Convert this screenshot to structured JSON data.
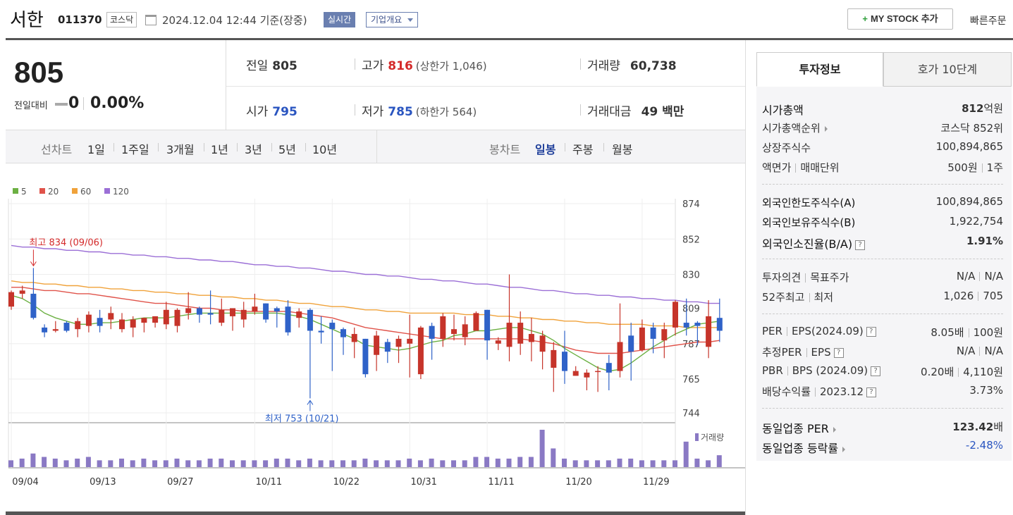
{
  "header": {
    "stock_name": "서한",
    "stock_code": "011370",
    "market_badge": "코스닥",
    "timestamp": "2024.12.04 12:44 기준(장중)",
    "realtime_badge": "실시간",
    "company_overview": "기업개요",
    "my_stock_label": "MY STOCK 추가",
    "quick_order": "빠른주문"
  },
  "price": {
    "current": "805",
    "change_label": "전일대비",
    "change": "0",
    "change_pct": "0.00%"
  },
  "stats": {
    "prev_close_label": "전일",
    "prev_close": "805",
    "high_label": "고가",
    "high": "816",
    "upper_limit": "(상한가 1,046)",
    "volume_label": "거래량",
    "volume": "60,738",
    "open_label": "시가",
    "open": "795",
    "low_label": "저가",
    "low": "785",
    "lower_limit": "(하한가 564)",
    "amount_label": "거래대금",
    "amount": "49 백만"
  },
  "controls": {
    "line_chart_label": "선차트",
    "line_periods": [
      "1일",
      "1주일",
      "3개월",
      "1년",
      "3년",
      "5년",
      "10년"
    ],
    "candle_chart_label": "봉차트",
    "candle_periods": [
      "일봉",
      "주봉",
      "월봉"
    ],
    "active_candle": "일봉"
  },
  "chart_data": {
    "type": "candlestick",
    "legend": [
      {
        "name": "5",
        "color": "#6cb043"
      },
      {
        "name": "20",
        "color": "#e0534a"
      },
      {
        "name": "60",
        "color": "#f0a23a"
      },
      {
        "name": "120",
        "color": "#9b6fd6"
      }
    ],
    "y_ticks": [
      874,
      852,
      830,
      809,
      787,
      765,
      744
    ],
    "ylim": [
      740,
      880
    ],
    "x_ticks": [
      "09/04",
      "09/13",
      "09/27",
      "10/11",
      "10/22",
      "10/31",
      "11/11",
      "11/20",
      "11/29"
    ],
    "x_tick_index": [
      0,
      7,
      14,
      22,
      29,
      36,
      43,
      50,
      57
    ],
    "high_annotation": "최고 834 (09/06)",
    "high_index": 2,
    "high_value": 834,
    "low_annotation": "최저 753 (10/21)",
    "low_index": 27,
    "low_value": 753,
    "volume_legend": "거래량",
    "candles": [
      [
        810,
        819,
        820,
        808
      ],
      [
        818,
        820,
        823,
        815
      ],
      [
        818,
        803,
        834,
        802
      ],
      [
        797,
        794,
        799,
        791
      ],
      [
        795,
        796,
        801,
        794
      ],
      [
        800,
        795,
        801,
        794
      ],
      [
        796,
        801,
        803,
        791
      ],
      [
        798,
        805,
        807,
        794
      ],
      [
        803,
        798,
        808,
        794
      ],
      [
        802,
        806,
        810,
        796
      ],
      [
        796,
        802,
        806,
        794
      ],
      [
        797,
        802,
        804,
        791
      ],
      [
        800,
        803,
        803,
        794
      ],
      [
        800,
        804,
        804,
        797
      ],
      [
        799,
        808,
        813,
        796
      ],
      [
        798,
        808,
        809,
        794
      ],
      [
        806,
        809,
        819,
        802
      ],
      [
        809,
        805,
        810,
        800
      ],
      [
        806,
        805,
        820,
        799
      ],
      [
        800,
        808,
        815,
        798
      ],
      [
        804,
        809,
        809,
        795
      ],
      [
        802,
        808,
        813,
        797
      ],
      [
        807,
        810,
        818,
        805
      ],
      [
        812,
        802,
        812,
        800
      ],
      [
        809,
        807,
        810,
        797
      ],
      [
        810,
        794,
        814,
        792
      ],
      [
        803,
        807,
        809,
        797
      ],
      [
        808,
        795,
        809,
        753
      ],
      [
        795,
        794,
        804,
        787
      ],
      [
        800,
        796,
        802,
        770
      ],
      [
        796,
        791,
        797,
        780
      ],
      [
        788,
        793,
        797,
        778
      ],
      [
        790,
        768,
        790,
        766
      ],
      [
        780,
        792,
        795,
        770
      ],
      [
        788,
        782,
        790,
        775
      ],
      [
        785,
        790,
        792,
        775
      ],
      [
        787,
        790,
        805,
        766
      ],
      [
        768,
        797,
        798,
        765
      ],
      [
        798,
        790,
        800,
        777
      ],
      [
        790,
        804,
        806,
        785
      ],
      [
        793,
        796,
        805,
        789
      ],
      [
        791,
        799,
        804,
        786
      ],
      [
        795,
        806,
        807,
        795
      ],
      [
        808,
        789,
        808,
        777
      ],
      [
        787,
        789,
        791,
        783
      ],
      [
        785,
        800,
        830,
        776
      ],
      [
        787,
        800,
        807,
        780
      ],
      [
        788,
        793,
        803,
        776
      ],
      [
        782,
        792,
        795,
        771
      ],
      [
        772,
        783,
        788,
        757
      ],
      [
        782,
        770,
        795,
        762
      ],
      [
        767,
        770,
        773,
        767
      ],
      [
        766,
        769,
        771,
        758
      ],
      [
        770,
        770,
        773,
        757
      ],
      [
        775,
        769,
        780,
        758
      ],
      [
        770,
        788,
        812,
        766
      ],
      [
        792,
        782,
        800,
        764
      ],
      [
        783,
        797,
        802,
        782
      ],
      [
        797,
        790,
        800,
        781
      ],
      [
        789,
        796,
        800,
        778
      ],
      [
        797,
        813,
        814,
        792
      ],
      [
        800,
        797,
        815,
        792
      ],
      [
        800,
        798,
        801,
        786
      ],
      [
        785,
        804,
        814,
        778
      ],
      [
        803,
        795,
        815,
        788
      ]
    ],
    "volumes": [
      4,
      5,
      8,
      6,
      5,
      4,
      5,
      6,
      4,
      4,
      5,
      4,
      5,
      4,
      4,
      5,
      4,
      4,
      5,
      5,
      4,
      4,
      4,
      4,
      5,
      5,
      4,
      5,
      4,
      4,
      4,
      4,
      5,
      4,
      4,
      4,
      5,
      4,
      5,
      4,
      4,
      4,
      6,
      6,
      5,
      5,
      6,
      6,
      22,
      11,
      5,
      4,
      4,
      4,
      4,
      5,
      5,
      4,
      4,
      4,
      4,
      15,
      5,
      4,
      7,
      5
    ],
    "ma5": [
      817,
      815,
      811,
      806,
      803,
      801,
      799,
      799,
      800,
      800,
      801,
      802,
      803,
      803,
      803,
      804,
      805,
      806,
      806,
      806,
      806,
      806,
      806,
      806,
      806,
      805,
      804,
      802,
      799,
      796,
      793,
      790,
      786,
      785,
      784,
      783,
      784,
      786,
      788,
      789,
      792,
      793,
      795,
      795,
      796,
      797,
      797,
      795,
      793,
      789,
      784,
      780,
      776,
      772,
      770,
      771,
      775,
      780,
      785,
      789,
      793,
      796,
      799,
      800,
      801
    ],
    "ma20": [
      822,
      822,
      821,
      820,
      820,
      819,
      818,
      818,
      817,
      816,
      815,
      814,
      813,
      812,
      812,
      811,
      810,
      809,
      809,
      808,
      808,
      807,
      807,
      807,
      807,
      807,
      806,
      805,
      804,
      803,
      801,
      799,
      797,
      796,
      795,
      794,
      793,
      792,
      791,
      790,
      790,
      790,
      790,
      790,
      790,
      790,
      790,
      789,
      788,
      787,
      785,
      783,
      782,
      781,
      781,
      781,
      782,
      783,
      784,
      785,
      786,
      787,
      788,
      788,
      789
    ],
    "ma60": [
      826,
      825,
      825,
      824,
      824,
      823,
      823,
      822,
      822,
      821,
      821,
      820,
      820,
      819,
      819,
      818,
      818,
      817,
      817,
      816,
      816,
      815,
      815,
      814,
      814,
      813,
      812,
      812,
      811,
      810,
      810,
      809,
      808,
      808,
      807,
      807,
      806,
      806,
      806,
      806,
      806,
      805,
      805,
      805,
      804,
      804,
      803,
      803,
      802,
      802,
      801,
      801,
      800,
      800,
      799,
      799,
      799,
      799,
      798,
      798,
      798,
      797,
      797,
      797,
      797
    ],
    "ma120": [
      848,
      847,
      847,
      846,
      846,
      845,
      845,
      844,
      844,
      843,
      843,
      842,
      842,
      841,
      841,
      840,
      840,
      839,
      839,
      838,
      838,
      837,
      836,
      836,
      835,
      835,
      834,
      834,
      833,
      832,
      832,
      831,
      830,
      830,
      829,
      829,
      828,
      827,
      827,
      826,
      826,
      825,
      824,
      824,
      823,
      822,
      822,
      821,
      820,
      820,
      819,
      818,
      818,
      817,
      817,
      816,
      816,
      815,
      815,
      814,
      814,
      813,
      813,
      812,
      812
    ]
  },
  "right_panel": {
    "tab_active": "투자정보",
    "tab_inactive": "호가 10단계",
    "market_cap_label": "시가총액",
    "market_cap": "812",
    "market_cap_unit": "억원",
    "rank_label": "시가총액순위",
    "rank": "코스닥 852위",
    "listed_label": "상장주식수",
    "listed": "100,894,865",
    "par_label": "액면가",
    "unit_label": "매매단위",
    "par": "500원",
    "unit": "1주",
    "foreign_limit_label": "외국인한도주식수(A)",
    "foreign_limit": "100,894,865",
    "foreign_hold_label": "외국인보유주식수(B)",
    "foreign_hold": "1,922,754",
    "foreign_ratio_label": "외국인소진율(B/A)",
    "foreign_ratio": "1.91%",
    "opinion_label": "투자의견",
    "target_label": "목표주가",
    "opinion": "N/A",
    "target": "N/A",
    "w52_high_label": "52주최고",
    "w52_low_label": "최저",
    "w52_high": "1,026",
    "w52_low": "705",
    "per_label": "PER",
    "eps_label": "EPS(2024.09)",
    "per": "8.05배",
    "eps": "100원",
    "est_per_label": "추정PER",
    "est_eps_label": "EPS",
    "est_per": "N/A",
    "est_eps": "N/A",
    "pbr_label": "PBR",
    "bps_label": "BPS (2024.09)",
    "pbr": "0.20배",
    "bps": "4,110원",
    "div_label": "배당수익률",
    "div_year": "2023.12",
    "div": "3.73%",
    "ind_per_label": "동일업종 PER",
    "ind_per": "123.42",
    "ind_per_unit": "배",
    "ind_rate_label": "동일업종 등락률",
    "ind_rate": "-2.48%"
  }
}
